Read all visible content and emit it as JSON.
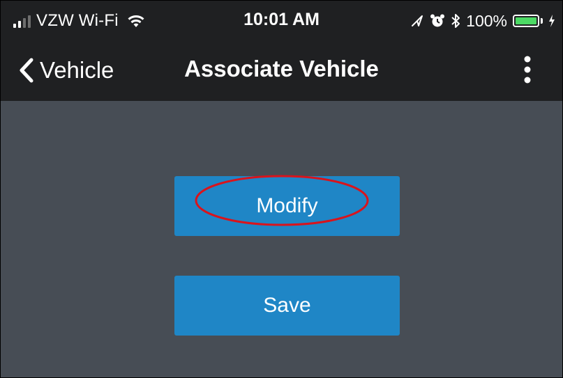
{
  "status_bar": {
    "carrier": "VZW Wi-Fi",
    "time": "10:01 AM",
    "battery_percent": "100%",
    "battery_level": 1.0,
    "signal_bars": 2,
    "icons": [
      "signal-icon",
      "wifi-icon",
      "location-arrow-icon",
      "alarm-icon",
      "bluetooth-icon",
      "battery-icon",
      "charging-bolt-icon"
    ],
    "battery_color": "#4cd964"
  },
  "nav_bar": {
    "back_label": "Vehicle",
    "title": "Associate Vehicle",
    "menu_icon": "more-vertical-icon"
  },
  "content": {
    "modify_label": "Modify",
    "save_label": "Save",
    "highlighted": "Modify",
    "highlight_color": "#d9141c"
  },
  "colors": {
    "bar_background": "#1f2022",
    "content_background": "#474d55",
    "button": "#1f86c6"
  }
}
